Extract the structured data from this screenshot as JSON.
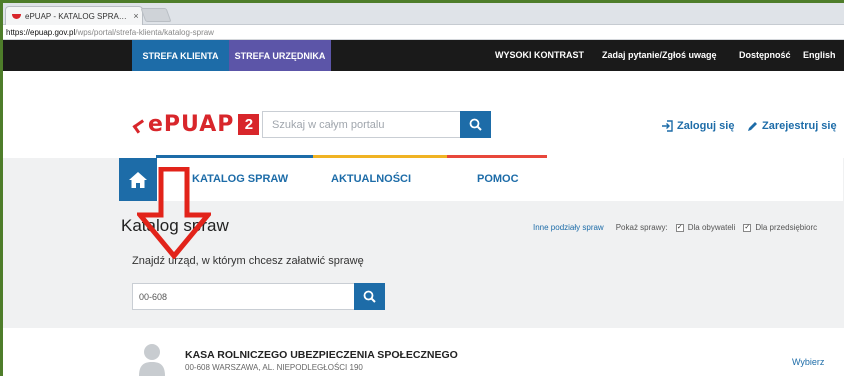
{
  "browser": {
    "tab_title": "ePUAP - KATALOG SPRA…",
    "tab_close": "×",
    "url_host": "https://epuap.gov.pl",
    "url_path": "/wps/portal/strefa-klienta/katalog-spraw"
  },
  "topbar": {
    "zone_client": "STREFA KLIENTA",
    "zone_official": "STREFA URZĘDNIKA",
    "high_contrast": "WYSOKI KONTRAST",
    "feedback": "Zadaj pytanie/Zgłoś uwagę",
    "accessibility": "Dostępność",
    "language": "English"
  },
  "header": {
    "logo_text": "ePUAP",
    "logo_number": "2",
    "search_placeholder": "Szukaj w całym portalu",
    "login": "Zaloguj się",
    "register": "Zarejestruj się"
  },
  "nav": {
    "items": [
      {
        "label": "KATALOG SPRAW"
      },
      {
        "label": "AKTUALNOŚCI"
      },
      {
        "label": "POMOC"
      }
    ]
  },
  "main": {
    "title": "Katalog spraw",
    "other_divisions": "Inne podziały spraw",
    "show_cases": "Pokaż sprawy:",
    "filter_citizens": "Dla obywateli",
    "filter_entrepreneurs": "Dla przedsiębiorc",
    "find_label": "Znajdź urząd, w którym chcesz załatwić sprawę",
    "find_value": "00-608"
  },
  "result": {
    "name": "KASA ROLNICZEGO UBEZPIECZENIA SPOŁECZNEGO",
    "address": "00-608 WARSZAWA, AL. NIEPODLEGŁOŚCI 190",
    "choose": "Wybierz"
  },
  "colors": {
    "brand_blue": "#1d6ca8",
    "brand_red": "#d8262b",
    "zone_official": "#5c55a8",
    "stripe_blue": "#1d6ca8",
    "stripe_yellow": "#f0b323",
    "stripe_red": "#e8473b"
  }
}
